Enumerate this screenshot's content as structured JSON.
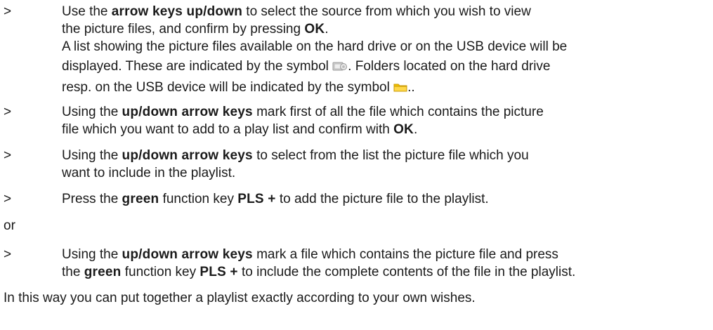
{
  "marker": ">",
  "step1": {
    "a": "Use the ",
    "b": "arrow keys up/down",
    "c": " to select the source from which you wish to view",
    "d": "the picture files, and confirm by pressing ",
    "e": "OK",
    "f": ".",
    "g": "A list showing the picture files available on the hard drive or on the USB device will be",
    "h": "displayed. These are indicated by the symbol ",
    "i": ". Folders located on the hard drive",
    "j": "resp. on the USB device will be indicated by the symbol ",
    "k": ".."
  },
  "step2": {
    "a": "Using the ",
    "b": "up/down arrow keys",
    "c": " mark first of all the file which contains the picture",
    "d": "file which you want to add to a play list and confirm with ",
    "e": "OK",
    "f": "."
  },
  "step3": {
    "a": "Using the ",
    "b": "up/down arrow keys",
    "c": " to select from the list the picture file which you",
    "d": "want to include in the playlist."
  },
  "step4": {
    "a": "Press the ",
    "b": "green",
    "c": " function key ",
    "d": "PLS +",
    "e": " to add the picture file to the playlist."
  },
  "or_text": "or",
  "step5": {
    "a": "Using the ",
    "b": "up/down arrow keys",
    "c": " mark a file which contains the picture file and press",
    "d": "the ",
    "e": "green",
    "f": " function key ",
    "g": "PLS +",
    "h": " to include the complete contents of the file in the playlist."
  },
  "closing": "In this way you can put together a playlist exactly according to your own wishes.",
  "icons": {
    "picture_file": "picture-file-icon",
    "folder": "folder-icon"
  },
  "colors": {
    "text": "#1a1a1a",
    "folder": "#f2c200"
  }
}
